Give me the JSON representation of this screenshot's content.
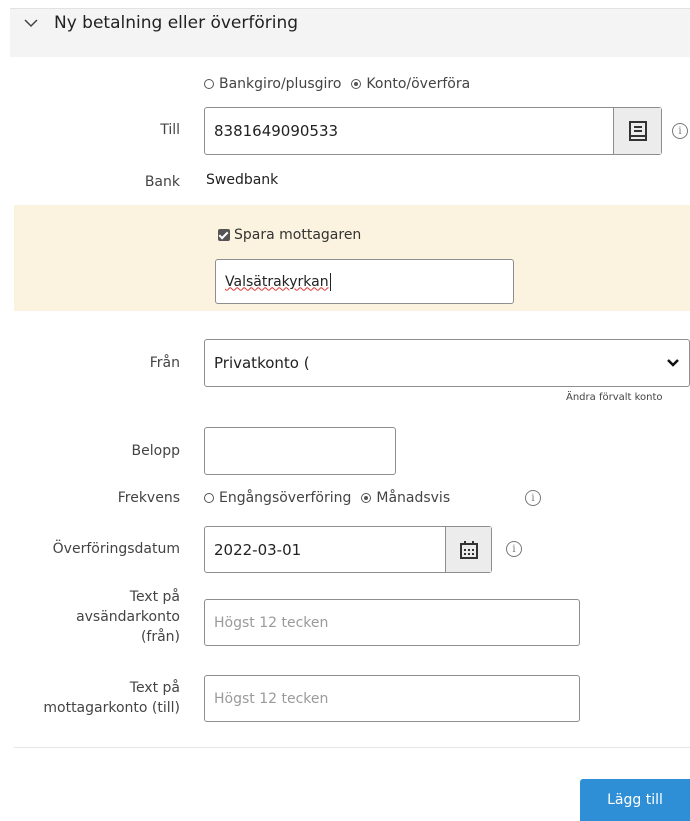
{
  "header": {
    "title": "Ny betalning eller överföring"
  },
  "payment_type": {
    "options": [
      "Bankgiro/plusgiro",
      "Konto/överföra"
    ],
    "selected": "Konto/överföra"
  },
  "recipient": {
    "label": "Till",
    "value": "8381649090533",
    "bank_label": "Bank",
    "bank_value": "Swedbank",
    "save_label": "Spara mottagaren",
    "save_checked": true,
    "name_value": "Valsätrakyrkan"
  },
  "from": {
    "label": "Från",
    "value": "Privatkonto (",
    "change_link": "Ändra förvalt konto"
  },
  "amount": {
    "label": "Belopp",
    "value": ""
  },
  "frequency": {
    "label": "Frekvens",
    "options": [
      "Engångsöverföring",
      "Månadsvis"
    ],
    "selected": "Månadsvis"
  },
  "date": {
    "label": "Överföringsdatum",
    "value": "2022-03-01"
  },
  "sender_text": {
    "label_lines": [
      "Text på",
      "avsändarkonto",
      "(från)"
    ],
    "placeholder": "Högst 12 tecken"
  },
  "recipient_text": {
    "label_lines": [
      "Text på",
      "mottagarkonto (till)"
    ],
    "placeholder": "Högst 12 tecken"
  },
  "submit": {
    "label": "Lägg till"
  },
  "colors": {
    "accent": "#2e8fd6",
    "highlight": "#fbf3df"
  }
}
